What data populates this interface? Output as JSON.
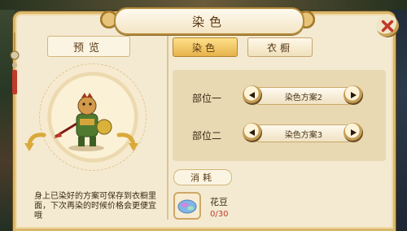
{
  "window": {
    "title": "染色"
  },
  "left": {
    "preview_label": "预览",
    "note": "身上已染好的方案可保存到衣橱里面，下次再染的时候价格会更便宜哦"
  },
  "tabs": [
    {
      "label": "染色",
      "active": true
    },
    {
      "label": "衣橱",
      "active": false
    }
  ],
  "parts": [
    {
      "label": "部位一",
      "value": "染色方案2"
    },
    {
      "label": "部位二",
      "value": "染色方案3"
    }
  ],
  "consumption": {
    "label": "消耗",
    "item_name": "花豆",
    "item_count": "0/30"
  },
  "colors": {
    "panel_bg": "#f4ead2",
    "active_tab": "#e6b24b",
    "count_red": "#c0392b",
    "close_red": "#c0392b"
  },
  "icons": {
    "close": "close-icon",
    "prev": "arrow-left-icon",
    "next": "arrow-right-icon",
    "rotate_left": "rotate-left-icon",
    "rotate_right": "rotate-right-icon",
    "item": "flower-bean-icon"
  }
}
